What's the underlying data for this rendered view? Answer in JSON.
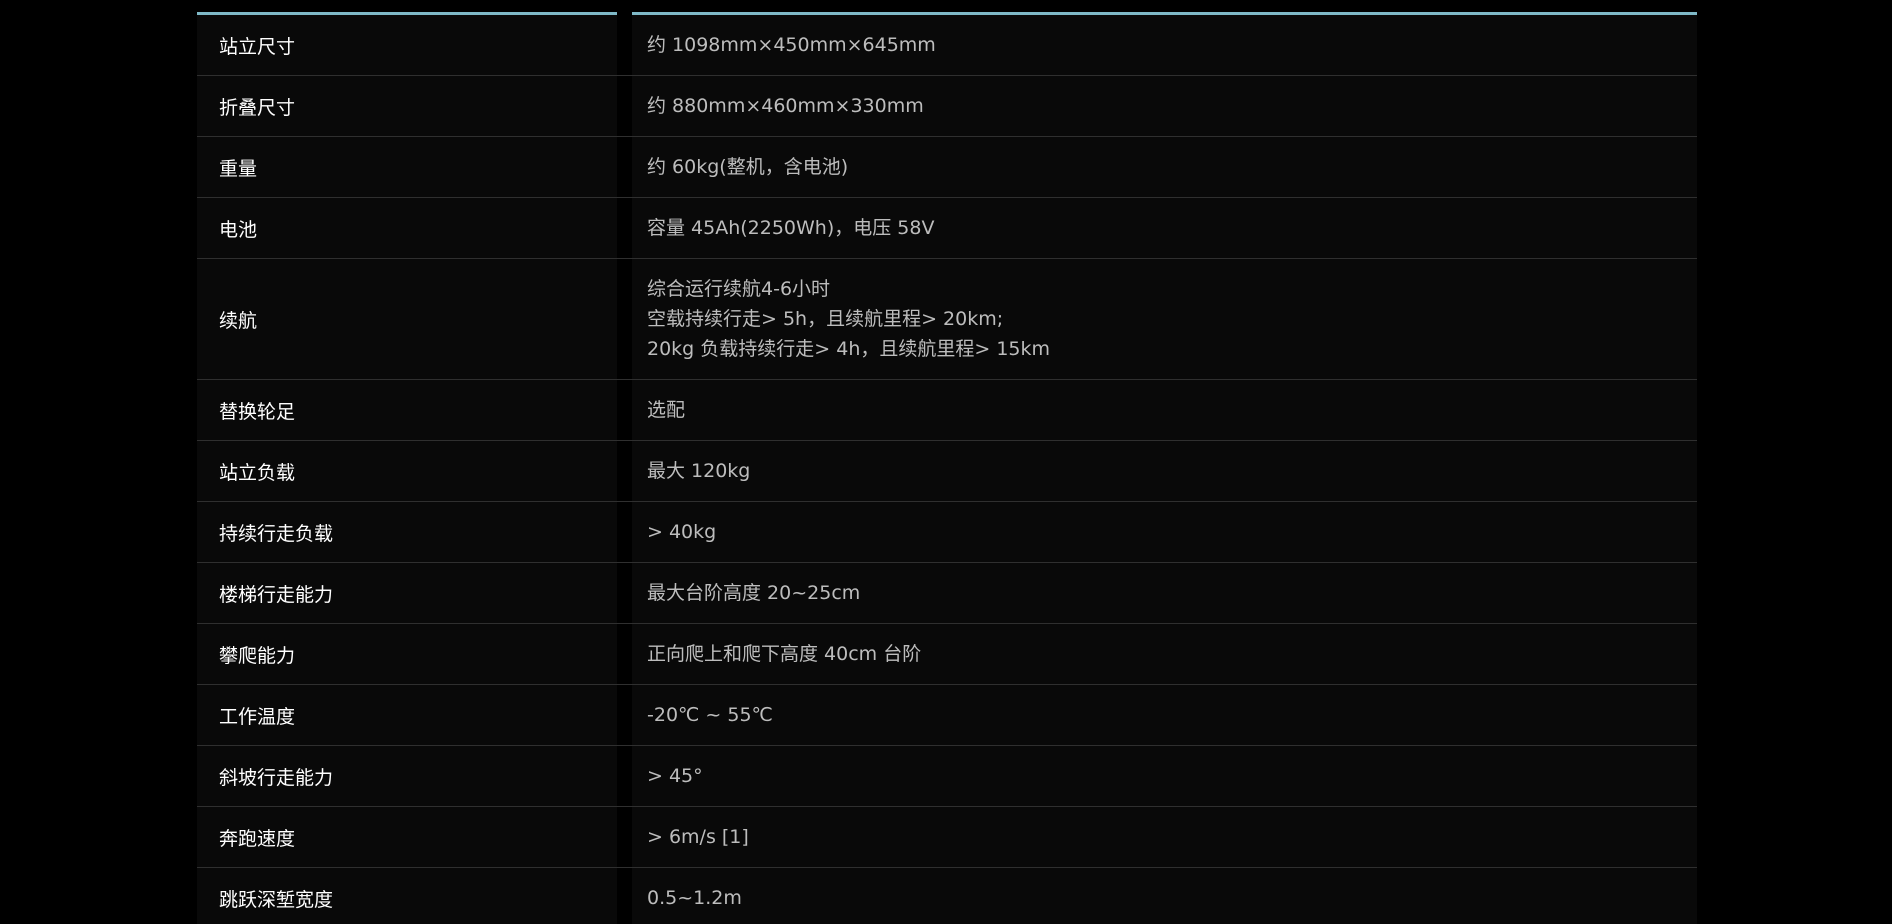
{
  "rows": [
    {
      "label": "站立尺寸",
      "value": [
        "约 1098mm×450mm×645mm"
      ]
    },
    {
      "label": "折叠尺寸",
      "value": [
        "约 880mm×460mm×330mm"
      ]
    },
    {
      "label": "重量",
      "value": [
        "约 60kg(整机，含电池)"
      ]
    },
    {
      "label": "电池",
      "value": [
        "容量 45Ah(2250Wh)，电压 58V"
      ]
    },
    {
      "label": "续航",
      "value": [
        "综合运行续航4-6小时",
        "空载持续行走> 5h，且续航里程> 20km;",
        "20kg 负载持续行走> 4h，且续航里程> 15km"
      ]
    },
    {
      "label": "替换轮足",
      "value": [
        "选配"
      ]
    },
    {
      "label": "站立负载",
      "value": [
        "最大 120kg"
      ]
    },
    {
      "label": "持续行走负载",
      "value": [
        "> 40kg"
      ]
    },
    {
      "label": "楼梯行走能力",
      "value": [
        "最大台阶高度 20~25cm"
      ]
    },
    {
      "label": "攀爬能力",
      "value": [
        "正向爬上和爬下高度 40cm 台阶"
      ]
    },
    {
      "label": "工作温度",
      "value": [
        "-20℃ ~ 55℃"
      ]
    },
    {
      "label": "斜坡行走能力",
      "value": [
        "> 45°"
      ]
    },
    {
      "label": "奔跑速度",
      "value": [
        "> 6m/s [1]"
      ]
    },
    {
      "label": "跳跃深堑宽度",
      "value": [
        "0.5~1.2m"
      ]
    }
  ]
}
